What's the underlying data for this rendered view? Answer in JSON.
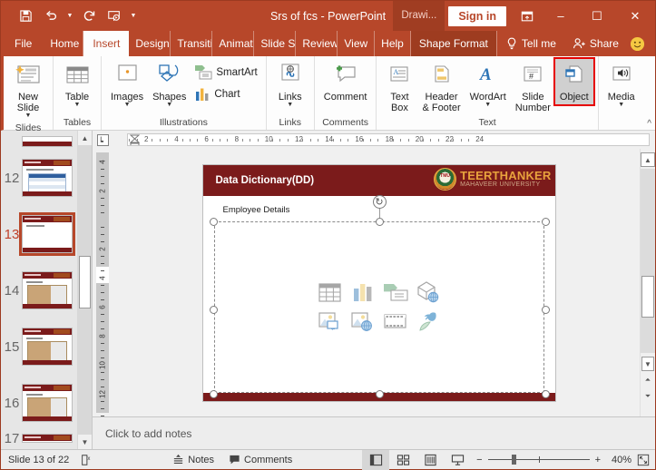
{
  "window": {
    "title": "Srs of fcs  -  PowerPoint",
    "quick_access": [
      "save-icon",
      "undo-icon",
      "redo-icon",
      "start-presentation-icon",
      "customize-qat-icon"
    ],
    "drawing_tab": "Drawi...",
    "sign_in": "Sign in",
    "ribbon_display_options": "ribbon-display-options-icon",
    "minimize": "–",
    "restore": "☐",
    "close": "✕"
  },
  "tabs": [
    {
      "label": "File",
      "active": false
    },
    {
      "label": "Home",
      "active": false
    },
    {
      "label": "Insert",
      "active": true
    },
    {
      "label": "Design",
      "active": false
    },
    {
      "label": "Transitions",
      "active": false
    },
    {
      "label": "Animations",
      "active": false
    },
    {
      "label": "Slide Show",
      "active": false
    },
    {
      "label": "Review",
      "active": false
    },
    {
      "label": "View",
      "active": false
    },
    {
      "label": "Help",
      "active": false
    },
    {
      "label": "Shape Format",
      "active": false
    }
  ],
  "tellme": {
    "label": "Tell me",
    "icon": "lightbulb-icon"
  },
  "share": {
    "label": "Share",
    "icon": "share-person-icon"
  },
  "account_icon": "smiley-face-icon",
  "ribbon": {
    "groups": [
      {
        "name": "Slides",
        "label": "Slides",
        "items": [
          {
            "label": "New\nSlide",
            "icon": "new-slide-icon",
            "dropdown": true
          }
        ]
      },
      {
        "name": "Tables",
        "label": "Tables",
        "items": [
          {
            "label": "Table",
            "icon": "table-icon",
            "dropdown": true
          }
        ]
      },
      {
        "name": "Illustrations",
        "label": "Illustrations",
        "items": [
          {
            "label": "Images",
            "icon": "images-icon",
            "dropdown": true
          },
          {
            "label": "Shapes",
            "icon": "shapes-icon",
            "dropdown": true
          },
          {
            "label": "SmartArt",
            "icon": "smartart-icon",
            "dropdown": false
          },
          {
            "label": "Chart",
            "icon": "chart-icon",
            "dropdown": false
          }
        ]
      },
      {
        "name": "Links",
        "label": "Links",
        "items": [
          {
            "label": "Links",
            "icon": "links-icon",
            "dropdown": true
          }
        ]
      },
      {
        "name": "Comments",
        "label": "Comments",
        "items": [
          {
            "label": "Comment",
            "icon": "comment-icon",
            "dropdown": false
          }
        ]
      },
      {
        "name": "Text",
        "label": "Text",
        "items": [
          {
            "label": "Text\nBox",
            "icon": "text-box-icon",
            "dropdown": false
          },
          {
            "label": "Header\n& Footer",
            "icon": "header-footer-icon",
            "dropdown": false
          },
          {
            "label": "WordArt",
            "icon": "wordart-icon",
            "dropdown": true
          },
          {
            "label": "Slide\nNumber",
            "icon": "slide-number-icon",
            "dropdown": false
          },
          {
            "label": "Object",
            "icon": "object-icon",
            "dropdown": false,
            "highlighted": true
          }
        ]
      },
      {
        "name": "Media",
        "label": "",
        "items": [
          {
            "label": "Media",
            "icon": "media-icon",
            "dropdown": true
          }
        ]
      }
    ],
    "collapse_icon": "collapse-ribbon-icon"
  },
  "thumbnails": {
    "slides": [
      {
        "number": "12",
        "selected": false,
        "kind": "table"
      },
      {
        "number": "13",
        "selected": true,
        "kind": "blank"
      },
      {
        "number": "14",
        "selected": false,
        "kind": "image2"
      },
      {
        "number": "15",
        "selected": false,
        "kind": "image2"
      },
      {
        "number": "16",
        "selected": false,
        "kind": "image2"
      },
      {
        "number": "17",
        "selected": false,
        "kind": "image2"
      }
    ]
  },
  "rulers": {
    "horizontal_ticks": [
      "2",
      "4",
      "6",
      "8",
      "10",
      "12",
      "14",
      "16",
      "18",
      "20",
      "22",
      "24"
    ],
    "vertical_ticks": [
      "4",
      "2",
      "",
      "2",
      "4",
      "6",
      "8",
      "10",
      "12"
    ],
    "corner_icon": "tab-stop-left-icon"
  },
  "slide": {
    "title": "Data Dictionary(DD)",
    "subtitle": "Employee Details",
    "logo": {
      "seal_text": "TMU",
      "line1": "TEERTHANKER",
      "line2": "MAHAVEER UNIVERSITY"
    },
    "placeholder_icons": [
      "insert-table-icon",
      "insert-chart-icon",
      "insert-smartart-icon",
      "insert-3d-model-icon",
      "insert-pictures-icon",
      "insert-online-pictures-icon",
      "insert-video-icon",
      "insert-icons-icon"
    ],
    "colors": {
      "header_maroon": "#7b1b1b",
      "logo_gold": "#e8a33d"
    }
  },
  "notes": {
    "placeholder": "Click to add notes"
  },
  "status": {
    "slide_counter": "Slide 13 of 22",
    "accessibility_icon": "accessibility-checker-icon",
    "notes_label": "Notes",
    "notes_icon": "notes-icon",
    "comments_label": "Comments",
    "comments_icon": "comments-icon",
    "views": [
      {
        "name": "normal-view",
        "icon": "normal-view-icon",
        "active": true
      },
      {
        "name": "slide-sorter-view",
        "icon": "slide-sorter-icon",
        "active": false
      },
      {
        "name": "reading-view",
        "icon": "reading-view-icon",
        "active": false
      },
      {
        "name": "slide-show-view",
        "icon": "slide-show-icon",
        "active": false
      }
    ],
    "zoom_out": "−",
    "zoom_in": "+",
    "zoom_level": "40%",
    "fit_icon": "fit-to-window-icon"
  },
  "theme": {
    "title_bar": "#b7472a",
    "ribbon_bg": "#fdfdfd",
    "highlight_outline": "#e60000",
    "selected_thumb": "#b7472a"
  }
}
